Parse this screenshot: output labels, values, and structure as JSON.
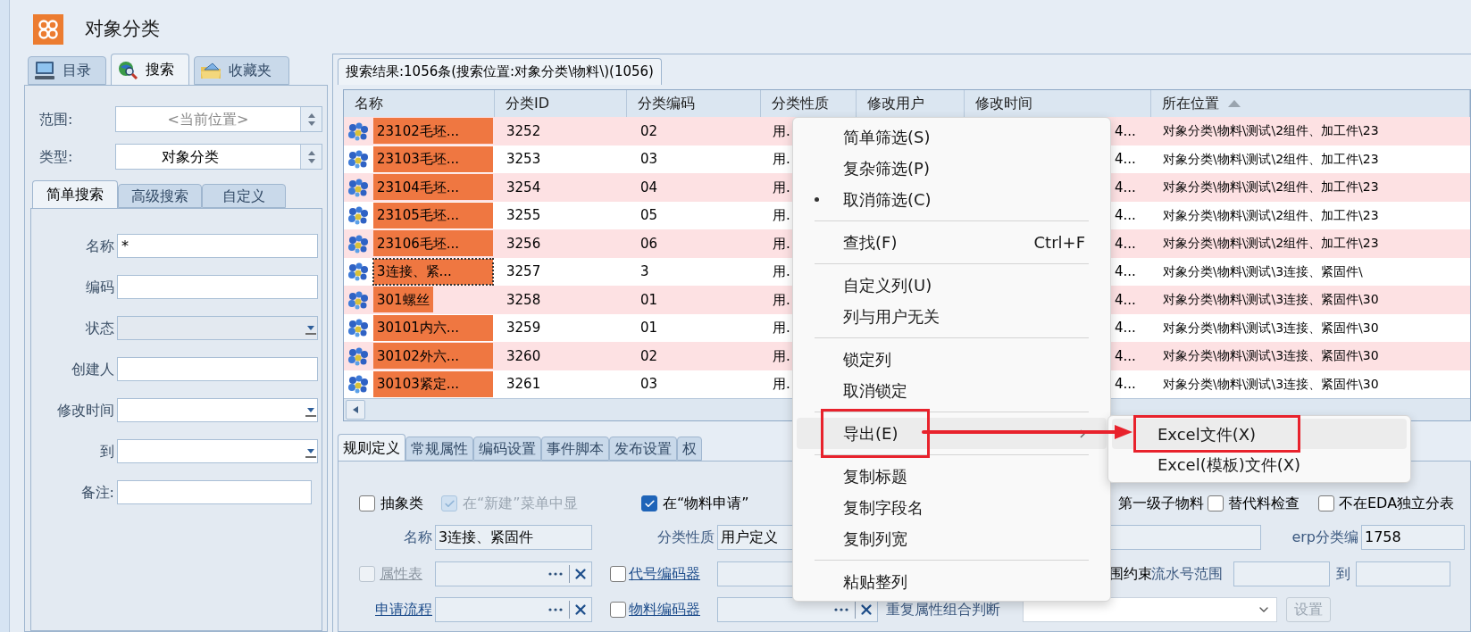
{
  "window": {
    "title": "对象分类"
  },
  "left_tabs": [
    {
      "label": "目录",
      "selected": false
    },
    {
      "label": "搜索",
      "selected": true
    },
    {
      "label": "收藏夹",
      "selected": false
    }
  ],
  "scope": {
    "label": "范围:",
    "placeholder": "<当前位置>"
  },
  "object_type": {
    "label": "类型:",
    "value": "对象分类"
  },
  "search_tabs": [
    {
      "label": "简单搜索",
      "selected": true
    },
    {
      "label": "高级搜索",
      "selected": false
    },
    {
      "label": "自定义",
      "selected": false
    }
  ],
  "search_fields": [
    {
      "label": "名称",
      "kind": "text",
      "value": "*",
      "disabled": false
    },
    {
      "label": "编码",
      "kind": "text",
      "disabled": false
    },
    {
      "label": "状态",
      "kind": "dropdown",
      "disabled": true
    },
    {
      "label": "创建人",
      "kind": "text",
      "disabled": false
    },
    {
      "label": "修改时间",
      "kind": "dropdown",
      "disabled": false
    },
    {
      "label": "到",
      "kind": "dropdown",
      "disabled": false
    },
    {
      "label": "备注:",
      "kind": "text",
      "disabled": false
    }
  ],
  "results_tab": {
    "label": "搜索结果:1056条(搜索位置:对象分类\\物料\\)(1056)",
    "selected": true
  },
  "table": {
    "columns": [
      {
        "label": "名称",
        "sorted": false
      },
      {
        "label": "分类ID",
        "sorted": false
      },
      {
        "label": "分类编码",
        "sorted": false
      },
      {
        "label": "分类性质",
        "sorted": false
      },
      {
        "label": "修改用户",
        "sorted": false
      },
      {
        "label": "修改时间",
        "sorted": false
      },
      {
        "label": "所在位置",
        "sorted": true
      }
    ],
    "rows": [
      {
        "name": "23102毛坯...",
        "truncated": true,
        "id": "3252",
        "code": "02",
        "nature": "用.",
        "modified_time": "4...",
        "location": "对象分类\\物料\\测试\\2组件、加工件\\23",
        "focused": false
      },
      {
        "name": "23103毛坯...",
        "truncated": true,
        "id": "3253",
        "code": "03",
        "nature": "用.",
        "modified_time": "4...",
        "location": "对象分类\\物料\\测试\\2组件、加工件\\23",
        "focused": false
      },
      {
        "name": "23104毛坯...",
        "truncated": true,
        "id": "3254",
        "code": "04",
        "nature": "用.",
        "modified_time": "4...",
        "location": "对象分类\\物料\\测试\\2组件、加工件\\23",
        "focused": false
      },
      {
        "name": "23105毛坯...",
        "truncated": true,
        "id": "3255",
        "code": "05",
        "nature": "用.",
        "modified_time": "4...",
        "location": "对象分类\\物料\\测试\\2组件、加工件\\23",
        "focused": false
      },
      {
        "name": "23106毛坯...",
        "truncated": true,
        "id": "3256",
        "code": "06",
        "nature": "用.",
        "modified_time": "4...",
        "location": "对象分类\\物料\\测试\\2组件、加工件\\23",
        "focused": false
      },
      {
        "name": "3连接、紧...",
        "truncated": true,
        "id": "3257",
        "code": "3",
        "nature": "用.",
        "modified_time": "4...",
        "location": "对象分类\\物料\\测试\\3连接、紧固件\\",
        "focused": true
      },
      {
        "name": "301螺丝",
        "truncated": false,
        "id": "3258",
        "code": "01",
        "nature": "用.",
        "modified_time": "4...",
        "location": "对象分类\\物料\\测试\\3连接、紧固件\\30",
        "focused": false
      },
      {
        "name": "30101内六...",
        "truncated": true,
        "id": "3259",
        "code": "01",
        "nature": "用.",
        "modified_time": "4...",
        "location": "对象分类\\物料\\测试\\3连接、紧固件\\30",
        "focused": false
      },
      {
        "name": "30102外六...",
        "truncated": true,
        "id": "3260",
        "code": "02",
        "nature": "用.",
        "modified_time": "4...",
        "location": "对象分类\\物料\\测试\\3连接、紧固件\\30",
        "focused": false
      },
      {
        "name": "30103紧定...",
        "truncated": true,
        "id": "3261",
        "code": "03",
        "nature": "用.",
        "modified_time": "4...",
        "location": "对象分类\\物料\\测试\\3连接、紧固件\\30",
        "focused": false
      }
    ]
  },
  "detail_tabs": [
    {
      "label": "规则定义",
      "selected": true
    },
    {
      "label": "常规属性",
      "selected": false
    },
    {
      "label": "编码设置",
      "selected": false
    },
    {
      "label": "事件脚本",
      "selected": false
    },
    {
      "label": "发布设置",
      "selected": false
    },
    {
      "label": "权",
      "selected": false
    }
  ],
  "rule_form": {
    "options": [
      {
        "label": "抽象类",
        "checked": false,
        "disabled": false
      },
      {
        "label": "在“新建”菜单中显",
        "checked": true,
        "disabled": true
      },
      {
        "label": "在“物料申请”",
        "checked": true,
        "disabled": false
      }
    ],
    "sub_material_label": "第一级子物料",
    "right_options": [
      {
        "label": "替代料检查",
        "checked": false,
        "disabled": false
      },
      {
        "label": "不在EDA独立分表",
        "checked": false,
        "disabled": false
      }
    ],
    "name": {
      "label": "名称",
      "value": "3连接、紧固件"
    },
    "nature": {
      "label": "分类性质",
      "value": "用户定义"
    },
    "erp_code": {
      "label": "erp分类编",
      "value": "1758"
    },
    "attribute_table": {
      "label": "属性表",
      "checked": false,
      "disabled": true
    },
    "code_encoder": {
      "label": "代号编码器",
      "checked": false
    },
    "range_constraint": {
      "label": "围约束"
    },
    "serial_range": {
      "label": "流水号范围",
      "to": "到"
    },
    "apply_flow": {
      "label": "申请流程"
    },
    "material_encoder": {
      "label": "物料编码器",
      "checked": false
    },
    "duplicate_check": {
      "label": "重复属性组合判断"
    },
    "settings_button": {
      "label": "设置",
      "disabled": true
    }
  },
  "context_menu": {
    "items": [
      {
        "kind": "item",
        "label": "简单筛选(S)",
        "checked": false,
        "highlighted": false,
        "has_submenu": false,
        "annotated": false
      },
      {
        "kind": "item",
        "label": "复杂筛选(P)",
        "checked": false,
        "highlighted": false,
        "has_submenu": false,
        "annotated": false
      },
      {
        "kind": "item",
        "label": "取消筛选(C)",
        "checked": true,
        "highlighted": false,
        "has_submenu": false,
        "annotated": false
      },
      {
        "kind": "separator"
      },
      {
        "kind": "item",
        "label": "查找(F)",
        "shortcut": "Ctrl+F",
        "checked": false,
        "highlighted": false,
        "has_submenu": false,
        "annotated": false
      },
      {
        "kind": "separator"
      },
      {
        "kind": "item",
        "label": "自定义列(U)",
        "checked": false,
        "highlighted": false,
        "has_submenu": false,
        "annotated": false
      },
      {
        "kind": "item",
        "label": "列与用户无关",
        "checked": false,
        "highlighted": false,
        "has_submenu": false,
        "annotated": false
      },
      {
        "kind": "separator"
      },
      {
        "kind": "item",
        "label": "锁定列",
        "checked": false,
        "highlighted": false,
        "has_submenu": false,
        "annotated": false
      },
      {
        "kind": "item",
        "label": "取消锁定",
        "checked": false,
        "highlighted": false,
        "has_submenu": false,
        "annotated": false
      },
      {
        "kind": "separator"
      },
      {
        "kind": "item",
        "label": "导出(E)",
        "checked": false,
        "highlighted": true,
        "has_submenu": true,
        "annotated": true
      },
      {
        "kind": "separator"
      },
      {
        "kind": "item",
        "label": "复制标题",
        "checked": false,
        "highlighted": false,
        "has_submenu": false,
        "annotated": false
      },
      {
        "kind": "item",
        "label": "复制字段名",
        "checked": false,
        "highlighted": false,
        "has_submenu": false,
        "annotated": false
      },
      {
        "kind": "item",
        "label": "复制列宽",
        "checked": false,
        "highlighted": false,
        "has_submenu": false,
        "annotated": false
      },
      {
        "kind": "separator"
      },
      {
        "kind": "item",
        "label": "粘贴整列",
        "checked": false,
        "highlighted": false,
        "has_submenu": false,
        "annotated": false
      }
    ]
  },
  "submenu": {
    "items": [
      {
        "label": "Excel文件(X)",
        "highlighted": true,
        "annotated": true
      },
      {
        "label": "Excel(模板)文件(X)",
        "highlighted": false,
        "annotated": false
      }
    ]
  }
}
